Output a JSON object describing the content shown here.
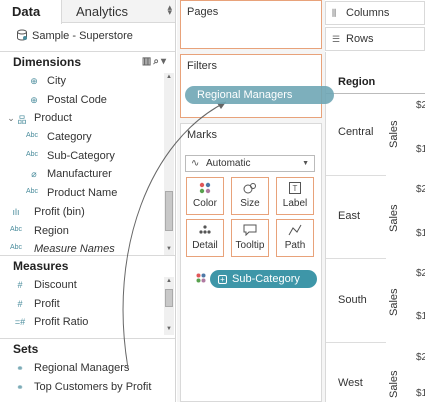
{
  "data_pane": {
    "tabs": {
      "data": "Data",
      "analytics": "Analytics"
    },
    "datasource": "Sample - Superstore",
    "dimensions_header": "Dimensions",
    "dimensions": [
      {
        "label": "City",
        "icon": "globe-icon"
      },
      {
        "label": "Postal Code",
        "icon": "globe-icon"
      },
      {
        "label": "Product",
        "icon": "hierarchy-icon"
      },
      {
        "label": "Category",
        "icon": "abc-icon"
      },
      {
        "label": "Sub-Category",
        "icon": "abc-icon"
      },
      {
        "label": "Manufacturer",
        "icon": "paperclip-icon"
      },
      {
        "label": "Product Name",
        "icon": "abc-icon"
      },
      {
        "label": "Profit (bin)",
        "icon": "bin-icon"
      },
      {
        "label": "Region",
        "icon": "abc-icon"
      },
      {
        "label": "Measure Names",
        "icon": "abc-icon"
      }
    ],
    "measures_header": "Measures",
    "measures": [
      {
        "label": "Discount",
        "icon": "hash-icon"
      },
      {
        "label": "Profit",
        "icon": "hash-icon"
      },
      {
        "label": "Profit Ratio",
        "icon": "hash-icon"
      }
    ],
    "sets_header": "Sets",
    "sets": [
      {
        "label": "Regional Managers",
        "icon": "set-icon"
      },
      {
        "label": "Top Customers by Profit",
        "icon": "set-icon"
      }
    ]
  },
  "cards": {
    "pages_title": "Pages",
    "filters_title": "Filters",
    "filter_pill": "Regional Managers",
    "marks_title": "Marks",
    "mark_type": "Automatic",
    "mark_buttons": [
      "Color",
      "Size",
      "Label",
      "Detail",
      "Tooltip",
      "Path"
    ],
    "subcategory_pill": "Sub-Category"
  },
  "shelves": {
    "columns": "Columns",
    "rows": "Rows"
  },
  "view": {
    "row_header": "Region",
    "regions": [
      "Central",
      "East",
      "South",
      "West"
    ],
    "measure_label": "Sales",
    "tick_prefix": "$2",
    "tick_prefix_2": "$1"
  },
  "colors": {
    "accent_teal": "#3e96a8",
    "drop_target_orange": "#e8a27a",
    "field_icon_teal": "#4a8c9c"
  }
}
